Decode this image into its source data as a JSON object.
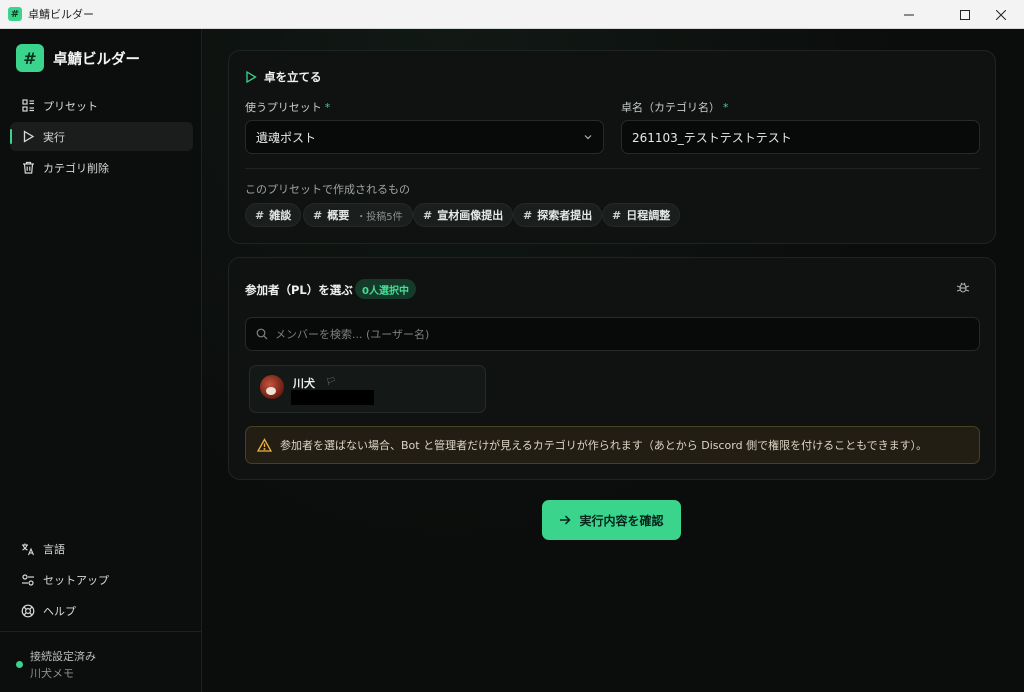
{
  "window": {
    "title": "卓鯖ビルダー"
  },
  "sidebar": {
    "brand": "卓鯖ビルダー",
    "brand_glyph": "#",
    "items": [
      {
        "label": "プリセット",
        "icon": "grid-list-icon"
      },
      {
        "label": "実行",
        "icon": "play-icon",
        "active": true
      },
      {
        "label": "カテゴリ削除",
        "icon": "trash-icon"
      }
    ],
    "bottom_items": [
      {
        "label": "言語",
        "icon": "translate-icon"
      },
      {
        "label": "セットアップ",
        "icon": "settings-sliders-icon"
      },
      {
        "label": "ヘルプ",
        "icon": "lifebuoy-icon"
      }
    ],
    "status": {
      "text": "接続設定済み",
      "user": "川犬メモ"
    }
  },
  "setup_card": {
    "title": "卓を立てる",
    "preset_label": "使うプリセット",
    "preset_value": "遺魂ポスト",
    "name_label": "卓名（カテゴリ名）",
    "name_value": "261103_テストテストテスト",
    "required_mark": "*",
    "creates_label": "このプリセットで作成されるもの",
    "channels": [
      {
        "name": "雑談"
      },
      {
        "name": "概要",
        "sub": "・投稿5件"
      },
      {
        "name": "宣材画像提出"
      },
      {
        "name": "探索者提出"
      },
      {
        "name": "日程調整"
      }
    ],
    "hash": "#"
  },
  "participants_card": {
    "title": "参加者（PL）を選ぶ",
    "badge": "0人選択中",
    "search_placeholder": "メンバーを検索... (ユーザー名)",
    "members": [
      {
        "name": "川犬",
        "tag": "🏳"
      }
    ],
    "warning": "参加者を選ばない場合、Bot と管理者だけが見えるカテゴリが作られます（あとから Discord 側で権限を付けることもできます）。"
  },
  "cta": {
    "label": "実行内容を確認"
  },
  "colors": {
    "accent": "#3ad48d",
    "warning": "#f0b443"
  }
}
